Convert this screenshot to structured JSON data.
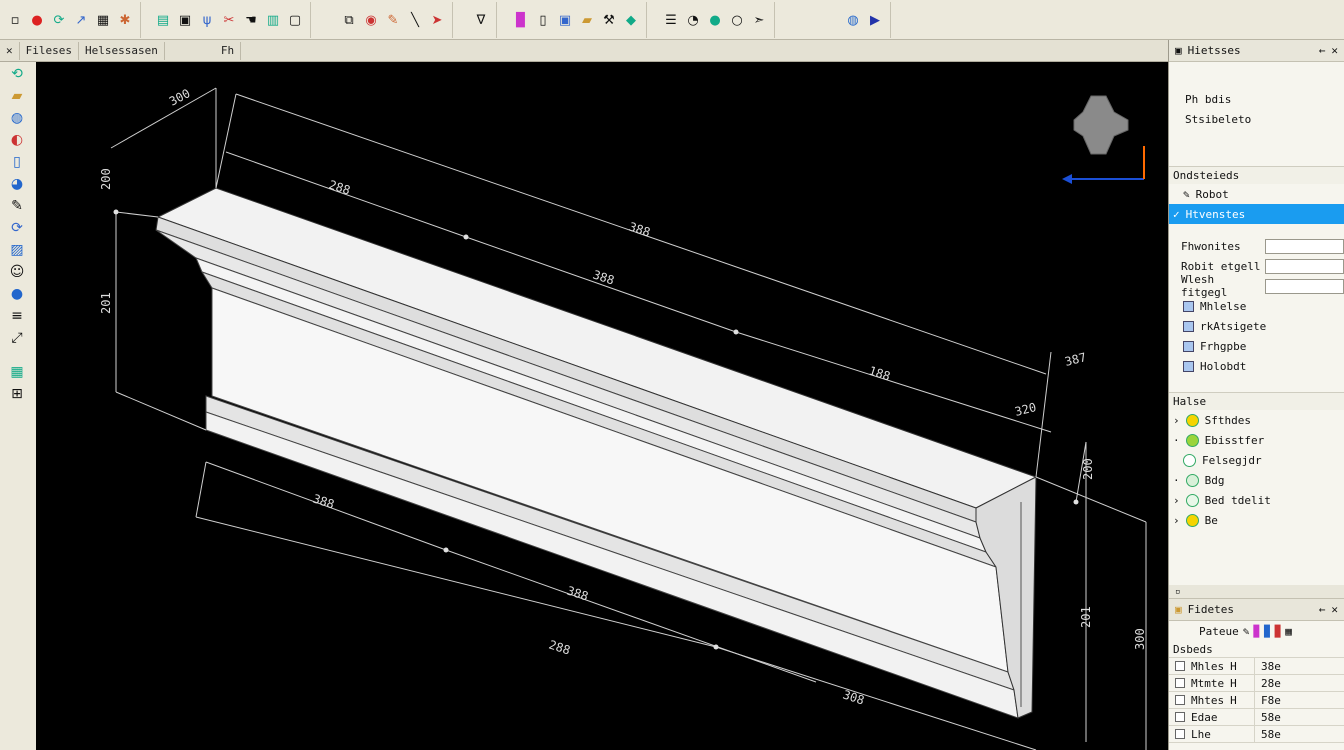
{
  "tabs": [
    "Fileses",
    "Helsessasen",
    "Fh"
  ],
  "right_panel": {
    "top_header": "Hietsses",
    "top_lines": [
      "Ph bdis",
      "Stsibeleto"
    ],
    "section1_title": "Ondsteieds",
    "section1_items": [
      "Robot",
      "Htvenstes"
    ],
    "fields": [
      "Fhwonites",
      "Robit etgell",
      "Wlesh fitgegl"
    ],
    "check_items": [
      "Mhlelse",
      "rkAtsigete",
      "Frhgpbe",
      "Holobdt"
    ],
    "section2_title": "Halse",
    "layers": [
      "Sfthdes",
      "Ebisstfer",
      "Felsegjdr",
      "Bdg",
      "Bed tdelit",
      "Be"
    ],
    "lower_header": "Fidetes",
    "lower_sub": "Pateue",
    "lower_section": "Dsbeds",
    "grid_rows": [
      {
        "name": "Mhles",
        "code": "H",
        "value": "38e"
      },
      {
        "name": "Mtmte",
        "code": "H",
        "value": "28e"
      },
      {
        "name": "Mhtes",
        "code": "H",
        "value": "F8e"
      },
      {
        "name": "Edae",
        "code": "",
        "value": "58e"
      },
      {
        "name": "Lhe",
        "code": "",
        "value": "58e"
      }
    ]
  },
  "dimensions": {
    "d_top_left": "300",
    "d_left_a": "200",
    "d_left_b": "201",
    "d_top1": "288",
    "d_top2": "388",
    "d_mid": "388",
    "d_mid2": "188",
    "d_right_top": "387",
    "d_right_small": "320",
    "d_right_v1": "200",
    "d_bottom1": "388",
    "d_bottom2": "388",
    "d_bottom3": "288",
    "d_bottom4": "308",
    "d_right_v2": "201",
    "d_right_v3": "300"
  },
  "colors": {
    "viewport_bg": "#000000",
    "selection": "#1a9cf0",
    "axis_x": "#1b4fd6",
    "axis_z": "#ff6a00"
  }
}
